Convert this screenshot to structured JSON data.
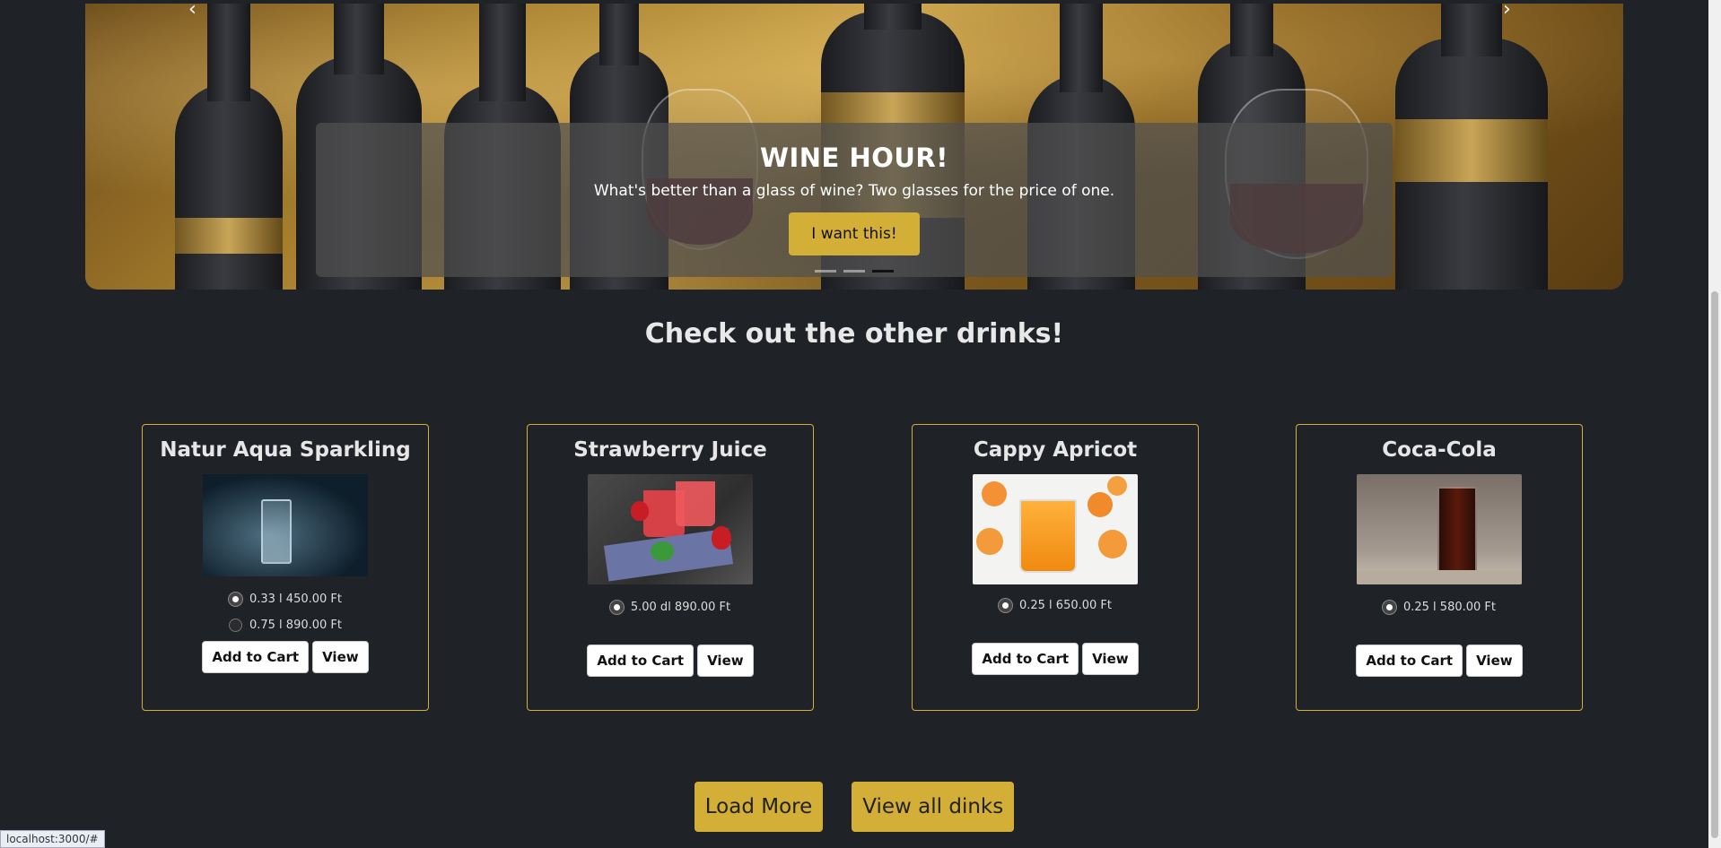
{
  "carousel": {
    "title": "WINE HOUR!",
    "text": "What's better than a glass of wine? Two glasses for the price of one.",
    "button": "I want this!",
    "prev_icon": "chevron-left-icon",
    "next_icon": "chevron-right-icon",
    "indicators": 3,
    "active_indicator": 2
  },
  "section_title": "Check out the other drinks!",
  "products": [
    {
      "name": "Natur Aqua Sparkling",
      "image": "sparkling-water-glass",
      "options": [
        "0.33 l 450.00 Ft",
        "0.75 l 890.00 Ft"
      ],
      "add_label": "Add to Cart",
      "view_label": "View"
    },
    {
      "name": "Strawberry Juice",
      "image": "strawberry-juice",
      "options": [
        "5.00 dl 890.00 Ft"
      ],
      "add_label": "Add to Cart",
      "view_label": "View"
    },
    {
      "name": "Cappy Apricot",
      "image": "apricot-juice",
      "options": [
        "0.25 l 650.00 Ft"
      ],
      "add_label": "Add to Cart",
      "view_label": "View"
    },
    {
      "name": "Coca-Cola",
      "image": "cola-glass",
      "options": [
        "0.25 l 580.00 Ft"
      ],
      "add_label": "Add to Cart",
      "view_label": "View"
    }
  ],
  "footer_buttons": {
    "load_more": "Load More",
    "view_all": "View all dinks"
  },
  "status_url": "localhost:3000/#",
  "colors": {
    "background": "#1f2227",
    "accent": "#d4af37"
  }
}
